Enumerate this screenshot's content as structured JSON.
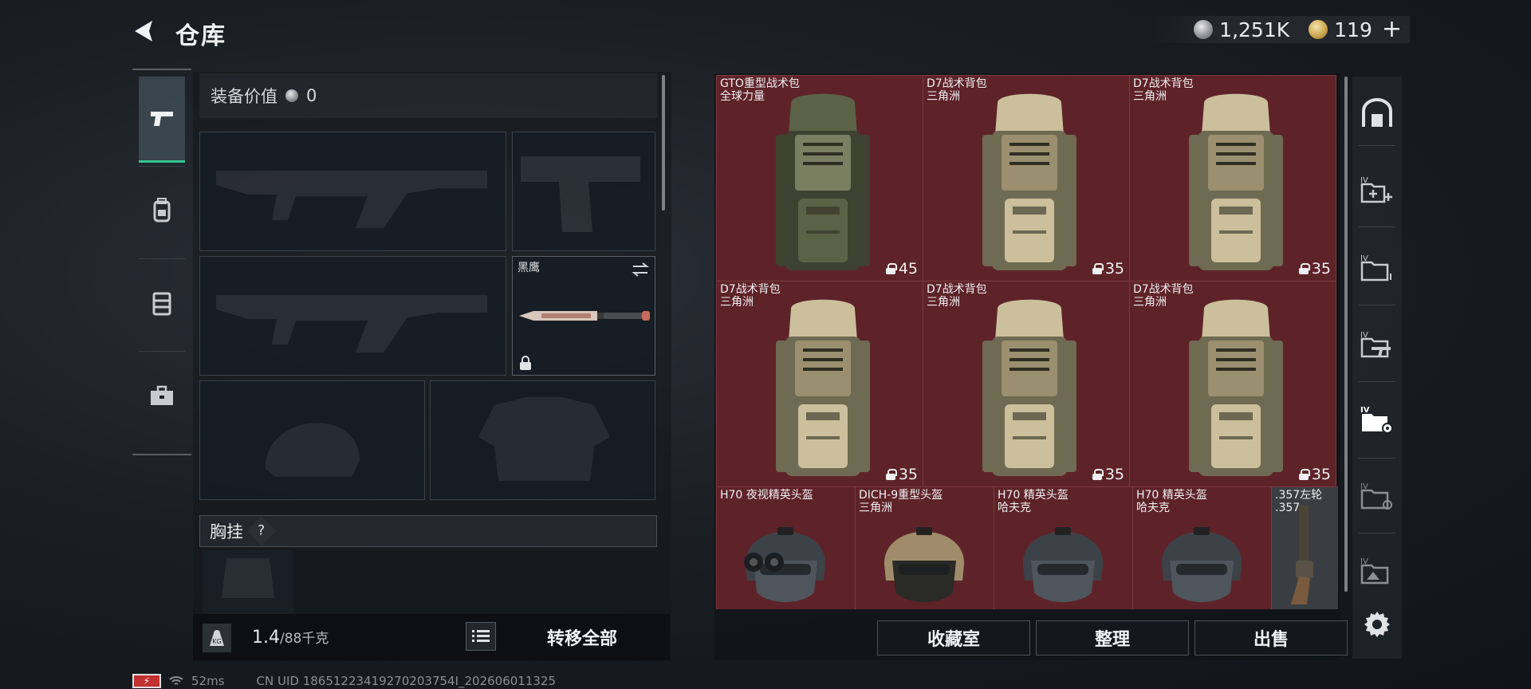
{
  "header": {
    "title": "仓库"
  },
  "currency": {
    "silver": "1,251K",
    "gold": "119"
  },
  "equipment": {
    "value_label": "装备价值",
    "value": "0",
    "knife_name": "黑鹰",
    "chest_label": "胸挂",
    "help": "?"
  },
  "footer_left": {
    "weight": "1.4",
    "capacity": "/88千克",
    "transfer_all": "转移全部"
  },
  "status": {
    "ping": "52ms",
    "uid": "CN UID 18651223419270203754I_202606011325"
  },
  "grid": {
    "bags": [
      {
        "name": "GTO重型战术包\n全球力量",
        "count": "45"
      },
      {
        "name": "D7战术背包\n三角洲",
        "count": "35"
      },
      {
        "name": "D7战术背包\n三角洲",
        "count": "35"
      },
      {
        "name": "D7战术背包\n三角洲",
        "count": "35"
      },
      {
        "name": "D7战术背包\n三角洲",
        "count": "35"
      },
      {
        "name": "D7战术背包\n三角洲",
        "count": "35"
      }
    ],
    "helmets": [
      {
        "name": "H70 夜视精英头盔"
      },
      {
        "name": "DICH-9重型头盔\n三角洲"
      },
      {
        "name": "H70 精英头盔\n哈夫克"
      },
      {
        "name": "H70 精英头盔\n哈夫克"
      },
      {
        "name": ".357左轮\n.357"
      }
    ]
  },
  "actions": {
    "collection": "收藏室",
    "organize": "整理",
    "sell": "出售"
  },
  "colors": {
    "accent_green": "#33c48f",
    "cell_red": "#5e2329"
  }
}
